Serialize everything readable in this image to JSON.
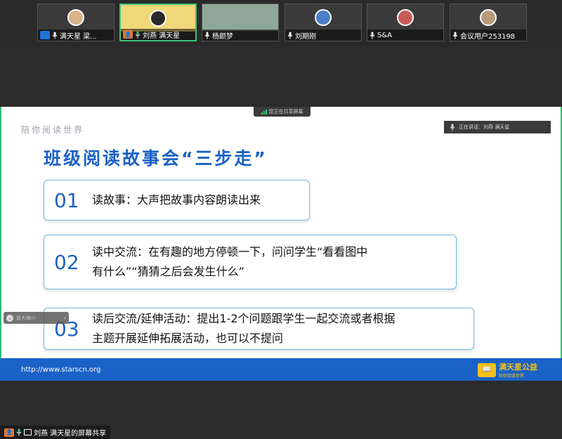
{
  "participants": [
    {
      "name": "满天星 梁...",
      "host": true,
      "muted": false
    },
    {
      "name": "刘燕 满天星",
      "host": true,
      "muted": false,
      "active": true
    },
    {
      "name": "杨颜梦",
      "host": false,
      "muted": false
    },
    {
      "name": "刘期刚",
      "host": false,
      "muted": false
    },
    {
      "name": "S&A",
      "host": false,
      "muted": false
    },
    {
      "name": "会议用户253198",
      "host": false,
      "muted": false
    }
  ],
  "share_status": "您正在共享屏幕",
  "speaking_label": "正在讲话：刘燕 满天星",
  "slide": {
    "slogan": "陪你阅读世界",
    "title": "班级阅读故事会“三步走”",
    "steps": [
      {
        "num": "01",
        "line1": "读故事：大声把故事内容朗读出来",
        "line2": ""
      },
      {
        "num": "02",
        "line1": "读中交流：在有趣的地方停顿一下，问问学生“看看图中",
        "line2": "有什么”“猜猜之后会发生什么”"
      },
      {
        "num": "03",
        "line1": "读后交流/延伸活动：提出1-2个问题跟学生一起交流或者根据",
        "line2": "主题开展延伸拓展活动，也可以不提问"
      }
    ],
    "footer_url": "http://www.starscn.org",
    "logo_name": "满天星公益",
    "logo_sub": "陪你阅读世界"
  },
  "float_control": "放大缩小",
  "bottom_status": "刘燕 满天星的屏幕共享"
}
